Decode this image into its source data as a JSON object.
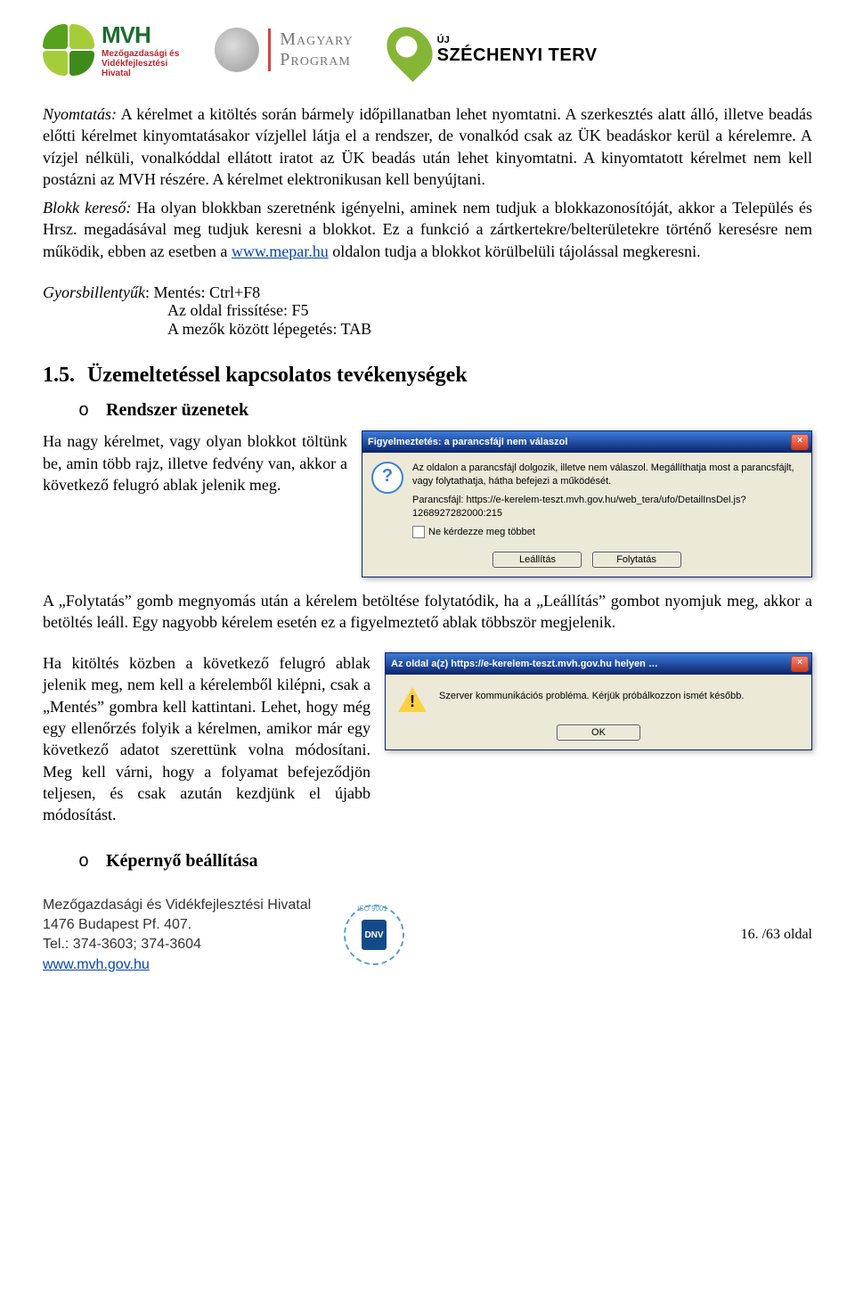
{
  "logos": {
    "mvh_title": "MVH",
    "mvh_sub": "Mezőgazdasági és\nVidékfejlesztési\nHivatal",
    "magyary": "Magyary\nProgram",
    "szechenyi_uj": "ÚJ",
    "szechenyi": "SZÉCHENYI TERV"
  },
  "nyomtatas": {
    "label": "Nyomtatás:",
    "text": "A kérelmet a kitöltés során bármely időpillanatban lehet nyomtatni. A szerkesztés alatt álló, illetve beadás előtti kérelmet kinyomtatásakor vízjellel látja el a rendszer, de vonalkód csak az ÜK beadáskor kerül a kérelemre. A vízjel nélküli, vonalkóddal ellátott iratot az ÜK beadás után lehet kinyomtatni. A kinyomtatott kérelmet nem kell postázni az MVH részére. A kérelmet elektronikusan kell benyújtani."
  },
  "blokk": {
    "label": "Blokk kereső:",
    "before_link": "Ha olyan blokkban szeretnénk igényelni, aminek nem tudjuk a blokkazonosítóját, akkor a Település és Hrsz. megadásával meg tudjuk keresni a blokkot. Ez a funkció a zártkertekre/belterületekre történő keresésre nem működik, ebben az esetben a ",
    "link_text": "www.mepar.hu",
    "after_link": " oldalon tudja a blokkot körülbelüli tájolással megkeresni."
  },
  "gyors": {
    "label": "Gyorsbillentyűk",
    "l1": "Mentés: Ctrl+F8",
    "l2": "Az oldal frissítése: F5",
    "l3": "A mezők között lépegetés: TAB"
  },
  "section": {
    "num": "1.5.",
    "title": "Üzemeltetéssel kapcsolatos tevékenységek"
  },
  "sub1": {
    "bullet": "o",
    "title": "Rendszer üzenetek"
  },
  "para_rendszer": "Ha nagy kérelmet, vagy olyan blokkot töltünk be, amin több rajz, illetve fedvény van, akkor a következő felugró ablak jelenik meg.",
  "dialog1": {
    "title": "Figyelmeztetés: a parancsfájl nem válaszol",
    "line1": "Az oldalon a parancsfájl dolgozik, illetve nem válaszol. Megállíthatja most a parancsfájlt, vagy folytathatja, hátha befejezi a működését.",
    "line2": "Parancsfájl: https://e-kerelem-teszt.mvh.gov.hu/web_tera/ufo/DetailInsDel.js?1268927282000:215",
    "checkbox": "Ne kérdezze meg többet",
    "btn_stop": "Leállítás",
    "btn_cont": "Folytatás"
  },
  "para_folytatas": "A „Folytatás” gomb megnyomás után a kérelem betöltése folytatódik, ha a „Leállítás” gombot nyomjuk meg, akkor a betöltés leáll. Egy nagyobb kérelem esetén ez a figyelmeztető ablak többször megjelenik.",
  "para_kitoltes": "Ha kitöltés közben a következő felugró ablak jelenik meg, nem kell a kérelemből kilépni, csak a „Mentés” gombra kell kattintani. Lehet, hogy még egy ellenőrzés folyik a kérelmen, amikor már egy következő adatot szerettünk volna módosítani. Meg kell várni, hogy a folyamat befejeződjön teljesen, és csak azután kezdjünk el újabb módosítást.",
  "dialog2": {
    "title": "Az oldal a(z) https://e-kerelem-teszt.mvh.gov.hu helyen …",
    "msg": "Szerver kommunikációs probléma. Kérjük próbálkozzon ismét később.",
    "btn_ok": "OK"
  },
  "sub2": {
    "bullet": "o",
    "title": "Képernyő beállítása"
  },
  "footer": {
    "org1": "Mezőgazdasági és Vidékfejlesztési Hivatal",
    "org2": "1476 Budapest Pf. 407.",
    "org3": "Tel.: 374-3603; 374-3604",
    "link": "www.mvh.gov.hu",
    "dnv": "DNV",
    "page": "16. /63 oldal"
  }
}
